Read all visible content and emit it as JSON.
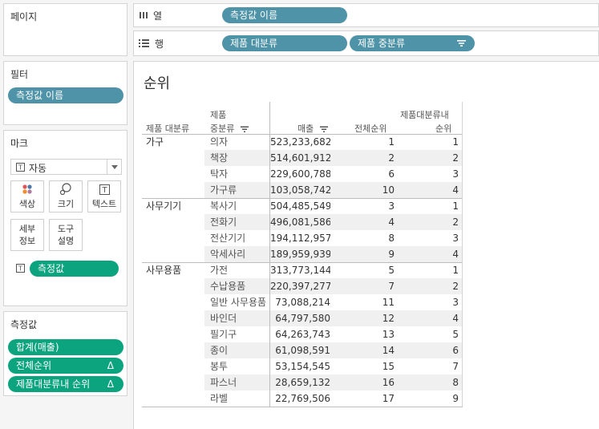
{
  "pages_panel": {
    "title": "페이지"
  },
  "columns_shelf": {
    "label": "열",
    "pills": [
      "측정값 이름"
    ]
  },
  "rows_shelf": {
    "label": "행",
    "pills": [
      "제품 대분류",
      "제품 중분류"
    ]
  },
  "filters_panel": {
    "title": "필터",
    "pills": [
      "측정값 이름"
    ]
  },
  "marks_panel": {
    "title": "마크",
    "mark_type": "자동",
    "buttons": [
      "색상",
      "크기",
      "텍스트",
      "세부\n정보",
      "도구\n설명"
    ],
    "measure_pill": "측정값"
  },
  "measure_values_panel": {
    "title": "측정값",
    "pills": [
      "합계(매출)",
      "전체순위",
      "제품대분류내 순위"
    ],
    "delta_symbol": "Δ"
  },
  "viz": {
    "title": "순위",
    "headers": {
      "category": "제품 대분류",
      "subcategory_line1": "제품",
      "subcategory_line2": "중분류",
      "sales": "매출",
      "overall_rank": "전체순위",
      "inner_rank_line1": "제품대분류내",
      "inner_rank_line2": "순위"
    },
    "groups": [
      {
        "category": "가구",
        "rows": [
          {
            "sub": "의자",
            "sales": "523,233,682",
            "overall": "1",
            "inner": "1"
          },
          {
            "sub": "책장",
            "sales": "514,601,912",
            "overall": "2",
            "inner": "2"
          },
          {
            "sub": "탁자",
            "sales": "229,600,788",
            "overall": "6",
            "inner": "3"
          },
          {
            "sub": "가구류",
            "sales": "103,058,742",
            "overall": "10",
            "inner": "4"
          }
        ]
      },
      {
        "category": "사무기기",
        "rows": [
          {
            "sub": "복사기",
            "sales": "504,485,549",
            "overall": "3",
            "inner": "1"
          },
          {
            "sub": "전화기",
            "sales": "496,081,586",
            "overall": "4",
            "inner": "2"
          },
          {
            "sub": "전산기기",
            "sales": "194,112,957",
            "overall": "8",
            "inner": "3"
          },
          {
            "sub": "악세사리",
            "sales": "189,959,939",
            "overall": "9",
            "inner": "4"
          }
        ]
      },
      {
        "category": "사무용품",
        "rows": [
          {
            "sub": "가전",
            "sales": "313,773,144",
            "overall": "5",
            "inner": "1"
          },
          {
            "sub": "수납용품",
            "sales": "220,397,277",
            "overall": "7",
            "inner": "2"
          },
          {
            "sub": "일반 사무용품",
            "sales": "73,088,214",
            "overall": "11",
            "inner": "3"
          },
          {
            "sub": "바인더",
            "sales": "64,797,580",
            "overall": "12",
            "inner": "4"
          },
          {
            "sub": "필기구",
            "sales": "64,263,743",
            "overall": "13",
            "inner": "5"
          },
          {
            "sub": "종이",
            "sales": "61,098,591",
            "overall": "14",
            "inner": "6"
          },
          {
            "sub": "봉투",
            "sales": "53,154,545",
            "overall": "15",
            "inner": "7"
          },
          {
            "sub": "파스너",
            "sales": "28,659,132",
            "overall": "16",
            "inner": "8"
          },
          {
            "sub": "라벨",
            "sales": "22,769,506",
            "overall": "17",
            "inner": "9"
          }
        ]
      }
    ]
  }
}
